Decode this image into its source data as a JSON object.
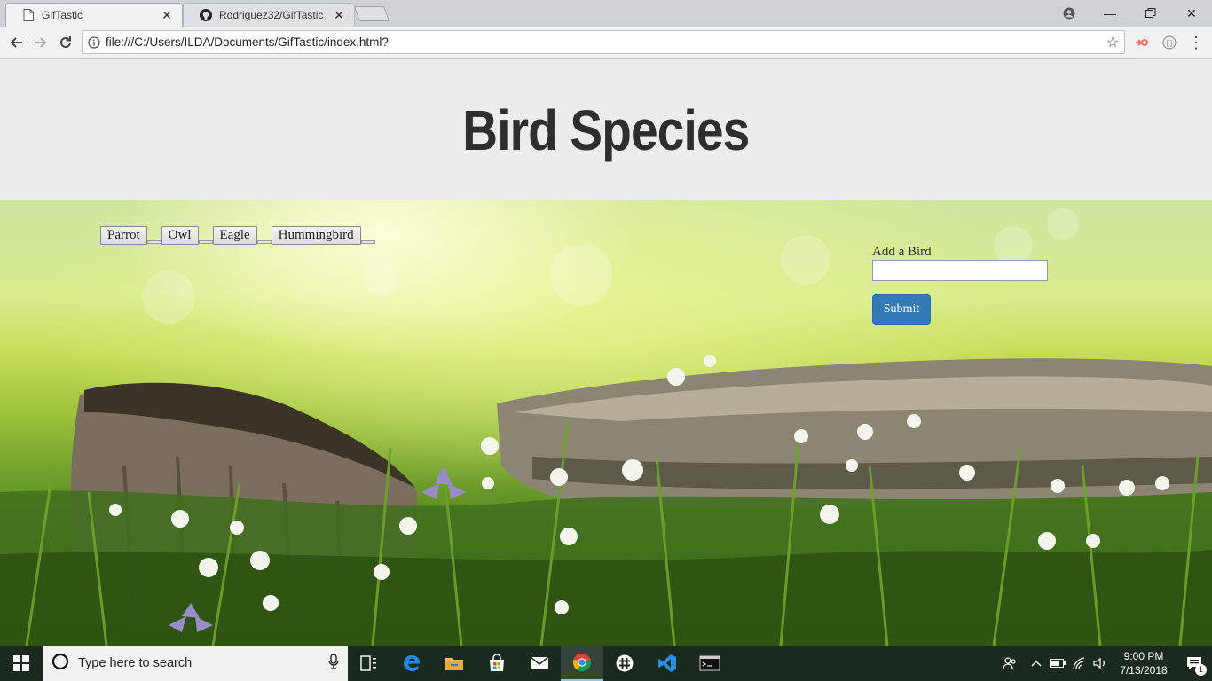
{
  "browser": {
    "tabs": [
      {
        "title": "GifTastic",
        "active": true,
        "favicon": "page-icon"
      },
      {
        "title": "Rodriguez32/GifTastic",
        "active": false,
        "favicon": "github-icon"
      }
    ],
    "address": "file:///C:/Users/ILDA/Documents/GifTastic/index.html?"
  },
  "page": {
    "title": "Bird Species",
    "buttons": [
      "Parrot",
      "Owl",
      "Eagle",
      "Hummingbird"
    ],
    "form": {
      "label": "Add a Bird",
      "input_value": "",
      "submit_label": "Submit"
    }
  },
  "taskbar": {
    "search_placeholder": "Type here to search",
    "time": "9:00 PM",
    "date": "7/13/2018",
    "notification_count": "1"
  },
  "colors": {
    "hero_bg": "#ececec",
    "title_color": "#2e2e2e",
    "submit_bg": "#337ab7",
    "taskbar_bg": "#1a2a1f"
  }
}
